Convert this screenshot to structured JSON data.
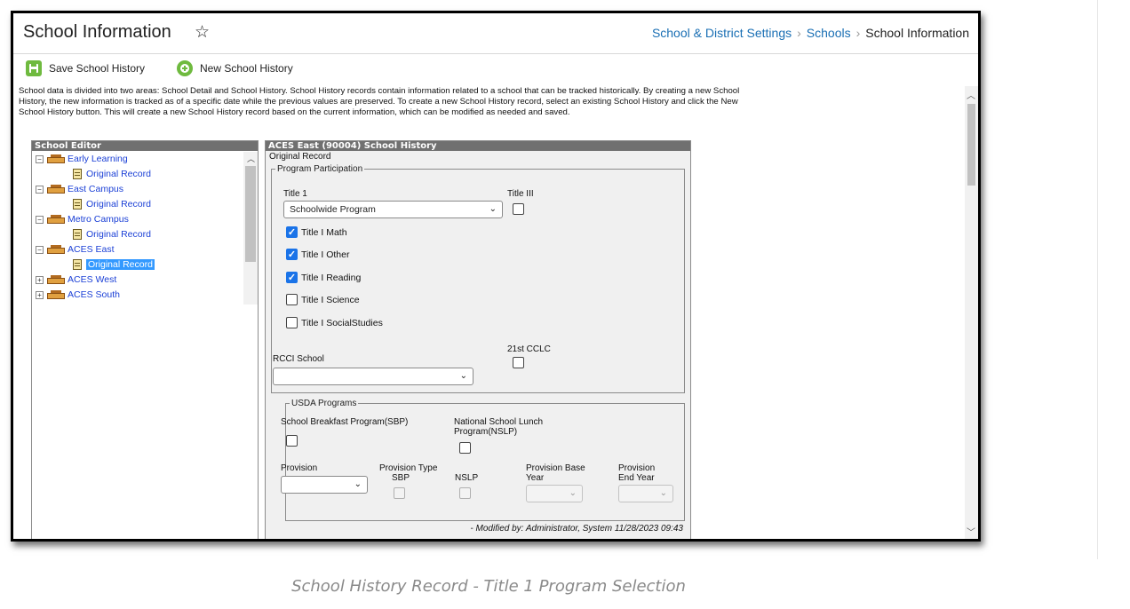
{
  "header": {
    "title": "School Information",
    "breadcrumbs": [
      "School & District Settings",
      "Schools",
      "School Information"
    ]
  },
  "toolbar": {
    "save_label": "Save School History",
    "new_label": "New School History",
    "save_icon": "save-icon",
    "new_icon": "add-icon"
  },
  "description": "School data is divided into two areas: School Detail and School History. School History records contain information related to a school that can be tracked historically. By creating a new School History, the new information is tracked as of a specific date while the previous values are preserved. To create a new School History record, select an existing School History and click the New School History button. This will create a new School History record based on the current information, which can be modified as needed and saved.",
  "editor": {
    "title": "School Editor",
    "schools": [
      {
        "name": "Early Learning",
        "record": "Original Record"
      },
      {
        "name": "East Campus",
        "record": "Original Record"
      },
      {
        "name": "Metro Campus",
        "record": "Original Record"
      },
      {
        "name": "ACES East",
        "record": "Original Record"
      },
      {
        "name": "ACES West"
      },
      {
        "name": "ACES South"
      }
    ]
  },
  "history": {
    "title": "ACES East (90004) School History",
    "subtitle": "Original Record",
    "program": {
      "legend": "Program Participation",
      "title1_label": "Title 1",
      "title1_value": "Schoolwide Program",
      "title3_label": "Title III",
      "checks": [
        {
          "label": "Title I Math",
          "checked": true
        },
        {
          "label": "Title I Other",
          "checked": true
        },
        {
          "label": "Title I Reading",
          "checked": true
        },
        {
          "label": "Title I Science",
          "checked": false
        },
        {
          "label": "Title I SocialStudies",
          "checked": false
        }
      ],
      "rcci_label": "RCCI School",
      "rcci_value": "",
      "cclc_label": "21st CCLC"
    },
    "usda": {
      "legend": "USDA Programs",
      "sbp_label": "School Breakfast Program(SBP)",
      "nslp_label_1": "National School Lunch",
      "nslp_label_2": "Program(NSLP)",
      "provision_label": "Provision",
      "ptype_label_1": "Provision Type",
      "ptype_sbp": "SBP",
      "ptype_nslp": "NSLP",
      "pbase_label_1": "Provision Base",
      "pbase_label_2": "Year",
      "pend_label_1": "Provision",
      "pend_label_2": "End Year"
    },
    "modified": "- Modified by: Administrator, System 11/28/2023 09:43"
  },
  "caption": "School History Record - Title 1 Program Selection",
  "colors": {
    "link": "#1a6fb4",
    "accent_green": "#6fba3f",
    "check_blue": "#1a73e8"
  }
}
